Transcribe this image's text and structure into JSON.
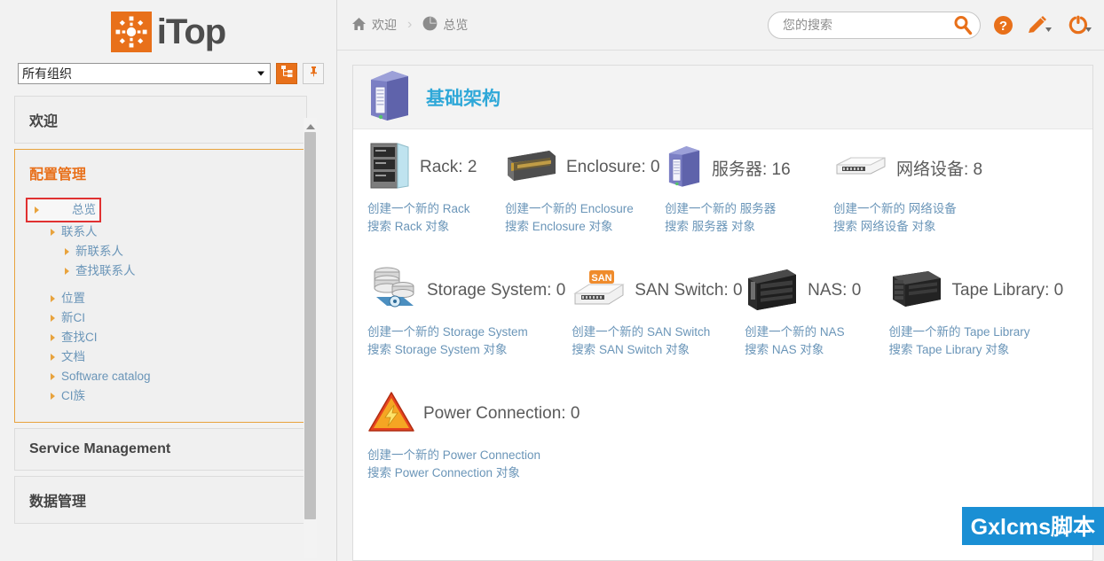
{
  "brand": {
    "name": "iTop",
    "logo_color": "#e8701a"
  },
  "org_selector": {
    "value": "所有组织",
    "tree_button_icon": "hierarchy-icon",
    "pin_button_icon": "pin-icon"
  },
  "sidebar": {
    "blocks": [
      {
        "title": "欢迎",
        "active": false,
        "items": []
      },
      {
        "title": "配置管理",
        "active": true,
        "items": [
          {
            "label": "总览",
            "level": 1,
            "selected": true
          },
          {
            "label": "联系人",
            "level": 1,
            "selected": false
          },
          {
            "label": "新联系人",
            "level": 2,
            "selected": false
          },
          {
            "label": "查找联系人",
            "level": 2,
            "selected": false
          },
          {
            "label": "位置",
            "level": 1,
            "selected": false
          },
          {
            "label": "新CI",
            "level": 1,
            "selected": false
          },
          {
            "label": "查找CI",
            "level": 1,
            "selected": false
          },
          {
            "label": "文档",
            "level": 1,
            "selected": false
          },
          {
            "label": "Software catalog",
            "level": 1,
            "selected": false
          },
          {
            "label": "CI族",
            "level": 1,
            "selected": false
          }
        ]
      },
      {
        "title": "Service Management",
        "active": false,
        "items": []
      },
      {
        "title": "数据管理",
        "active": false,
        "items": []
      }
    ]
  },
  "topbar": {
    "breadcrumb": [
      {
        "label": "欢迎",
        "icon": "home-icon"
      },
      {
        "label": "总览",
        "icon": "pie-chart-icon"
      }
    ],
    "separator": "›",
    "search": {
      "placeholder": "您的搜索",
      "value": "",
      "icon": "search-icon"
    },
    "icons": [
      {
        "name": "help-icon"
      },
      {
        "name": "pencil-icon"
      },
      {
        "name": "power-icon"
      }
    ]
  },
  "panel": {
    "title": "基础架构",
    "title_icon": "server-tower-icon",
    "title_color": "#2fa8d8",
    "rows": [
      {
        "cells": [
          {
            "icon": "rack-icon",
            "label": "Rack: 2",
            "name": "Rack",
            "count": 2,
            "create_link": "创建一个新的 Rack",
            "search_link": "搜索 Rack 对象"
          },
          {
            "icon": "enclosure-icon",
            "label": "Enclosure: 0",
            "name": "Enclosure",
            "count": 0,
            "create_link": "创建一个新的 Enclosure",
            "search_link": "搜索 Enclosure 对象"
          },
          {
            "icon": "server-tower-icon",
            "label": "服务器: 16",
            "name": "服务器",
            "count": 16,
            "create_link": "创建一个新的 服务器",
            "search_link": "搜索 服务器 对象"
          },
          {
            "icon": "network-device-icon",
            "label": "网络设备: 8",
            "name": "网络设备",
            "count": 8,
            "create_link": "创建一个新的 网络设备",
            "search_link": "搜索 网络设备 对象"
          }
        ]
      },
      {
        "cells": [
          {
            "icon": "storage-system-icon",
            "label": "Storage System: 0",
            "name": "Storage System",
            "count": 0,
            "create_link": "创建一个新的 Storage System",
            "search_link": "搜索 Storage System 对象"
          },
          {
            "icon": "san-switch-icon",
            "label": "SAN Switch: 0",
            "name": "SAN Switch",
            "count": 0,
            "create_link": "创建一个新的 SAN Switch",
            "search_link": "搜索 SAN Switch 对象"
          },
          {
            "icon": "nas-icon",
            "label": "NAS: 0",
            "name": "NAS",
            "count": 0,
            "create_link": "创建一个新的 NAS",
            "search_link": "搜索 NAS 对象"
          },
          {
            "icon": "tape-library-icon",
            "label": "Tape Library: 0",
            "name": "Tape Library",
            "count": 0,
            "create_link": "创建一个新的 Tape Library",
            "search_link": "搜索 Tape Library 对象"
          }
        ]
      },
      {
        "cells": [
          {
            "icon": "power-connection-icon",
            "label": "Power Connection: 0",
            "name": "Power Connection",
            "count": 0,
            "create_link": "创建一个新的 Power Connection",
            "search_link": "搜索 Power Connection 对象"
          }
        ]
      }
    ]
  },
  "watermark": {
    "text": "Gxlcms脚本",
    "color": "#1a8fd4"
  }
}
